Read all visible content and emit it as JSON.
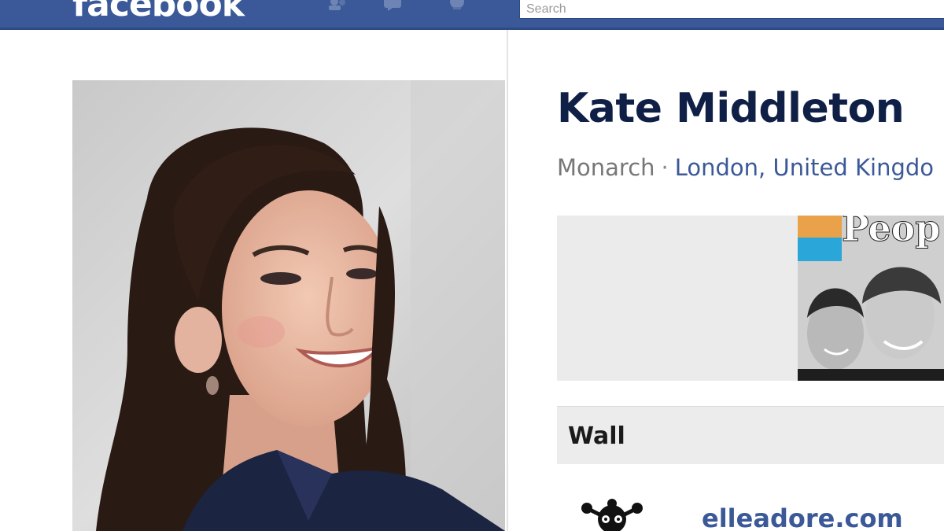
{
  "header": {
    "logo": "facebook",
    "search": {
      "value": "Search",
      "placeholder": "Search"
    },
    "icons": [
      "friends-icon",
      "messages-icon",
      "notifications-icon"
    ]
  },
  "profile": {
    "name": "Kate Middleton",
    "occupation": "Monarch",
    "separator": "·",
    "location": "London, United Kingdo"
  },
  "photos": {
    "magazine_masthead": "Peop"
  },
  "tabs": {
    "wall": "Wall"
  },
  "post": {
    "author": "elleadore.com"
  },
  "colors": {
    "brand": "#3b5998",
    "name": "#0f1f46",
    "link": "#3b5998",
    "muted": "#777777",
    "panel": "#ebebeb"
  }
}
